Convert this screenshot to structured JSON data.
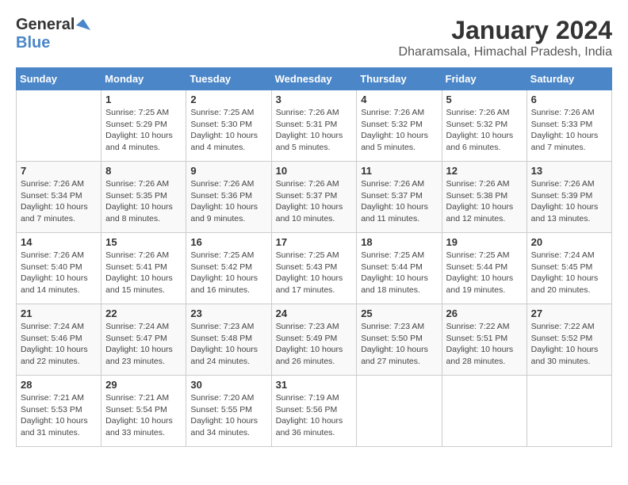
{
  "header": {
    "logo_general": "General",
    "logo_blue": "Blue",
    "title": "January 2024",
    "subtitle": "Dharamsala, Himachal Pradesh, India"
  },
  "weekdays": [
    "Sunday",
    "Monday",
    "Tuesday",
    "Wednesday",
    "Thursday",
    "Friday",
    "Saturday"
  ],
  "weeks": [
    [
      {
        "day": "",
        "info": ""
      },
      {
        "day": "1",
        "info": "Sunrise: 7:25 AM\nSunset: 5:29 PM\nDaylight: 10 hours\nand 4 minutes."
      },
      {
        "day": "2",
        "info": "Sunrise: 7:25 AM\nSunset: 5:30 PM\nDaylight: 10 hours\nand 4 minutes."
      },
      {
        "day": "3",
        "info": "Sunrise: 7:26 AM\nSunset: 5:31 PM\nDaylight: 10 hours\nand 5 minutes."
      },
      {
        "day": "4",
        "info": "Sunrise: 7:26 AM\nSunset: 5:32 PM\nDaylight: 10 hours\nand 5 minutes."
      },
      {
        "day": "5",
        "info": "Sunrise: 7:26 AM\nSunset: 5:32 PM\nDaylight: 10 hours\nand 6 minutes."
      },
      {
        "day": "6",
        "info": "Sunrise: 7:26 AM\nSunset: 5:33 PM\nDaylight: 10 hours\nand 7 minutes."
      }
    ],
    [
      {
        "day": "7",
        "info": "Sunrise: 7:26 AM\nSunset: 5:34 PM\nDaylight: 10 hours\nand 7 minutes."
      },
      {
        "day": "8",
        "info": "Sunrise: 7:26 AM\nSunset: 5:35 PM\nDaylight: 10 hours\nand 8 minutes."
      },
      {
        "day": "9",
        "info": "Sunrise: 7:26 AM\nSunset: 5:36 PM\nDaylight: 10 hours\nand 9 minutes."
      },
      {
        "day": "10",
        "info": "Sunrise: 7:26 AM\nSunset: 5:37 PM\nDaylight: 10 hours\nand 10 minutes."
      },
      {
        "day": "11",
        "info": "Sunrise: 7:26 AM\nSunset: 5:37 PM\nDaylight: 10 hours\nand 11 minutes."
      },
      {
        "day": "12",
        "info": "Sunrise: 7:26 AM\nSunset: 5:38 PM\nDaylight: 10 hours\nand 12 minutes."
      },
      {
        "day": "13",
        "info": "Sunrise: 7:26 AM\nSunset: 5:39 PM\nDaylight: 10 hours\nand 13 minutes."
      }
    ],
    [
      {
        "day": "14",
        "info": "Sunrise: 7:26 AM\nSunset: 5:40 PM\nDaylight: 10 hours\nand 14 minutes."
      },
      {
        "day": "15",
        "info": "Sunrise: 7:26 AM\nSunset: 5:41 PM\nDaylight: 10 hours\nand 15 minutes."
      },
      {
        "day": "16",
        "info": "Sunrise: 7:25 AM\nSunset: 5:42 PM\nDaylight: 10 hours\nand 16 minutes."
      },
      {
        "day": "17",
        "info": "Sunrise: 7:25 AM\nSunset: 5:43 PM\nDaylight: 10 hours\nand 17 minutes."
      },
      {
        "day": "18",
        "info": "Sunrise: 7:25 AM\nSunset: 5:44 PM\nDaylight: 10 hours\nand 18 minutes."
      },
      {
        "day": "19",
        "info": "Sunrise: 7:25 AM\nSunset: 5:44 PM\nDaylight: 10 hours\nand 19 minutes."
      },
      {
        "day": "20",
        "info": "Sunrise: 7:24 AM\nSunset: 5:45 PM\nDaylight: 10 hours\nand 20 minutes."
      }
    ],
    [
      {
        "day": "21",
        "info": "Sunrise: 7:24 AM\nSunset: 5:46 PM\nDaylight: 10 hours\nand 22 minutes."
      },
      {
        "day": "22",
        "info": "Sunrise: 7:24 AM\nSunset: 5:47 PM\nDaylight: 10 hours\nand 23 minutes."
      },
      {
        "day": "23",
        "info": "Sunrise: 7:23 AM\nSunset: 5:48 PM\nDaylight: 10 hours\nand 24 minutes."
      },
      {
        "day": "24",
        "info": "Sunrise: 7:23 AM\nSunset: 5:49 PM\nDaylight: 10 hours\nand 26 minutes."
      },
      {
        "day": "25",
        "info": "Sunrise: 7:23 AM\nSunset: 5:50 PM\nDaylight: 10 hours\nand 27 minutes."
      },
      {
        "day": "26",
        "info": "Sunrise: 7:22 AM\nSunset: 5:51 PM\nDaylight: 10 hours\nand 28 minutes."
      },
      {
        "day": "27",
        "info": "Sunrise: 7:22 AM\nSunset: 5:52 PM\nDaylight: 10 hours\nand 30 minutes."
      }
    ],
    [
      {
        "day": "28",
        "info": "Sunrise: 7:21 AM\nSunset: 5:53 PM\nDaylight: 10 hours\nand 31 minutes."
      },
      {
        "day": "29",
        "info": "Sunrise: 7:21 AM\nSunset: 5:54 PM\nDaylight: 10 hours\nand 33 minutes."
      },
      {
        "day": "30",
        "info": "Sunrise: 7:20 AM\nSunset: 5:55 PM\nDaylight: 10 hours\nand 34 minutes."
      },
      {
        "day": "31",
        "info": "Sunrise: 7:19 AM\nSunset: 5:56 PM\nDaylight: 10 hours\nand 36 minutes."
      },
      {
        "day": "",
        "info": ""
      },
      {
        "day": "",
        "info": ""
      },
      {
        "day": "",
        "info": ""
      }
    ]
  ]
}
